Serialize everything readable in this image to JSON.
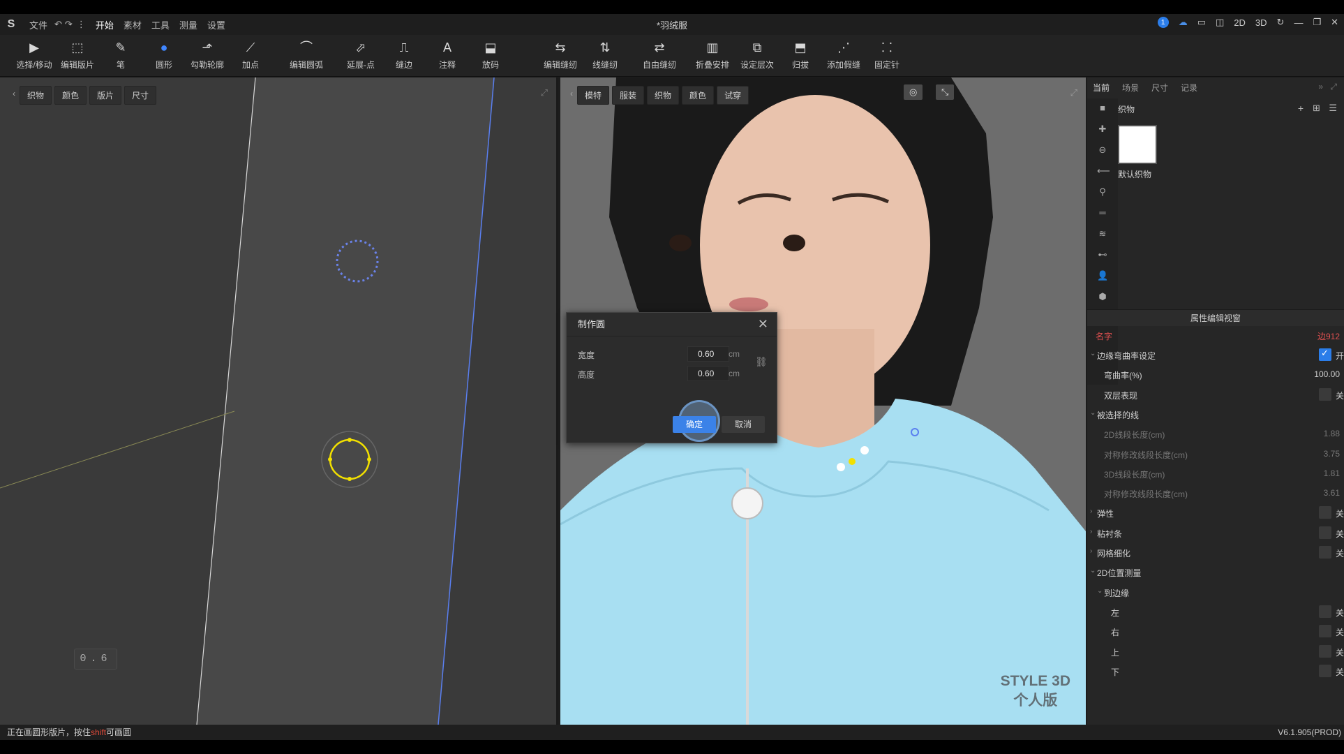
{
  "menubar": {
    "logo": "S",
    "items": [
      "文件",
      "开始",
      "素材",
      "工具",
      "测量",
      "设置"
    ],
    "title": "*羽绒服",
    "notif_count": "1",
    "right_labels": [
      "2D",
      "3D"
    ]
  },
  "toolbar": {
    "tools": [
      {
        "label": "选择/移动",
        "icon": "▶"
      },
      {
        "label": "编辑版片",
        "icon": "⬚"
      },
      {
        "label": "笔",
        "icon": "✎"
      },
      {
        "label": "圆形",
        "icon": "●"
      },
      {
        "label": "勾勒轮廓",
        "icon": "⬏"
      },
      {
        "label": "加点",
        "icon": "⟋"
      },
      {
        "label": "编辑圆弧",
        "icon": "⌒"
      },
      {
        "label": "延展-点",
        "icon": "⬀"
      },
      {
        "label": "缝边",
        "icon": "⎍"
      },
      {
        "label": "注释",
        "icon": "A"
      },
      {
        "label": "放码",
        "icon": "⬓"
      },
      {
        "label": "编辑缝纫",
        "icon": "⇆"
      },
      {
        "label": "线缝纫",
        "icon": "⇅"
      },
      {
        "label": "自由缝纫",
        "icon": "⇄"
      },
      {
        "label": "折叠安排",
        "icon": "▥"
      },
      {
        "label": "设定层次",
        "icon": "⧉"
      },
      {
        "label": "归拔",
        "icon": "⬒"
      },
      {
        "label": "添加假缝",
        "icon": "⋰"
      },
      {
        "label": "固定针",
        "icon": "⸬"
      }
    ]
  },
  "view2d": {
    "tabs": [
      "织物",
      "颜色",
      "版片",
      "尺寸"
    ],
    "readout": "0.6"
  },
  "view3d": {
    "tabs": [
      "模特",
      "服装",
      "织物",
      "颜色",
      "试穿"
    ],
    "watermark_line1": "STYLE 3D",
    "watermark_line2": "个人版"
  },
  "dialog": {
    "title": "制作圆",
    "width_label": "宽度",
    "width_value": "0.60",
    "height_label": "高度",
    "height_value": "0.60",
    "unit": "cm",
    "ok_label": "确定",
    "cancel_label": "取消"
  },
  "sidepanel": {
    "tabs": [
      "当前",
      "场景",
      "尺寸",
      "记录"
    ],
    "fabric_title": "织物",
    "swatch_label": "默认织物",
    "swatch_color": "#ffffff",
    "prop_header": "属性编辑视窗",
    "name_key": "名字",
    "name_value": "边912",
    "rows": [
      {
        "key": "边缘弯曲率设定",
        "toggle": "开",
        "checked": true,
        "indent": 1,
        "caret": "⌄"
      },
      {
        "key": "弯曲率(%)",
        "value": "100.00",
        "indent": 2
      },
      {
        "key": "双层表现",
        "toggle": "关",
        "checked": false,
        "indent": 2
      },
      {
        "key": "被选择的线",
        "indent": 1,
        "caret": "⌄"
      },
      {
        "key": "2D线段长度(cm)",
        "value": "1.88",
        "indent": 2,
        "dim": true
      },
      {
        "key": "对称修改线段长度(cm)",
        "value": "3.75",
        "indent": 2,
        "dim": true
      },
      {
        "key": "3D线段长度(cm)",
        "value": "1.81",
        "indent": 2,
        "dim": true
      },
      {
        "key": "对称修改线段长度(cm)",
        "value": "3.61",
        "indent": 2,
        "dim": true
      },
      {
        "key": "弹性",
        "toggle": "关",
        "checked": false,
        "indent": 1,
        "caret": "›"
      },
      {
        "key": "粘衬条",
        "toggle": "关",
        "checked": false,
        "indent": 1,
        "caret": "›"
      },
      {
        "key": "网格细化",
        "toggle": "关",
        "checked": false,
        "indent": 1,
        "caret": "›"
      },
      {
        "key": "2D位置测量",
        "indent": 1,
        "caret": "⌄"
      },
      {
        "key": "到边缘",
        "indent": 2,
        "caret": "⌄"
      },
      {
        "key": "左",
        "toggle": "关",
        "checked": false,
        "indent": 3
      },
      {
        "key": "右",
        "toggle": "关",
        "checked": false,
        "indent": 3
      },
      {
        "key": "上",
        "toggle": "关",
        "checked": false,
        "indent": 3
      },
      {
        "key": "下",
        "toggle": "关",
        "checked": false,
        "indent": 3
      }
    ]
  },
  "statusbar": {
    "prefix": "正在画圆形版片，按住",
    "key": "shift",
    "suffix": "可画圆",
    "version": "V6.1.905(PROD)"
  },
  "colors": {
    "accent": "#3b82e8",
    "circle_yellow": "#f2e000",
    "jacket": "#a8dff2"
  }
}
